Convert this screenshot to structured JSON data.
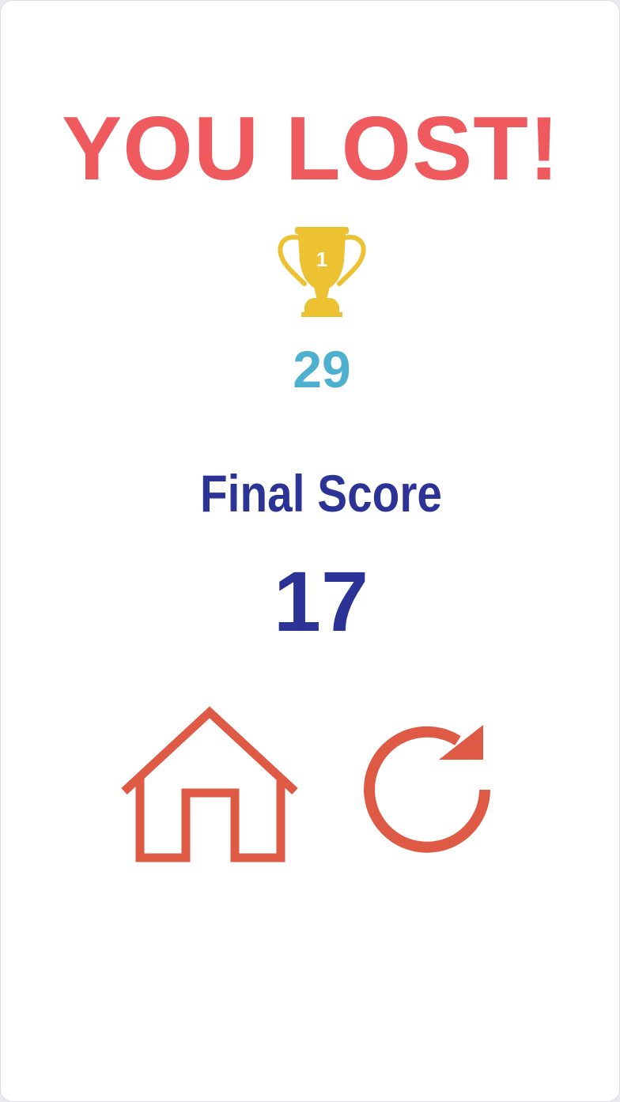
{
  "result": {
    "title": "YOU LOST!"
  },
  "best": {
    "icon": "trophy-icon",
    "badge": "1",
    "value": "29"
  },
  "final": {
    "label": "Final Score",
    "value": "17"
  },
  "actions": {
    "home_icon": "home-icon",
    "restart_icon": "restart-icon"
  },
  "colors": {
    "title": "#ee5a5e",
    "trophy": "#ecc233",
    "best_score": "#4eb0cf",
    "final_score": "#2c3396",
    "buttons": "#de5a45"
  }
}
